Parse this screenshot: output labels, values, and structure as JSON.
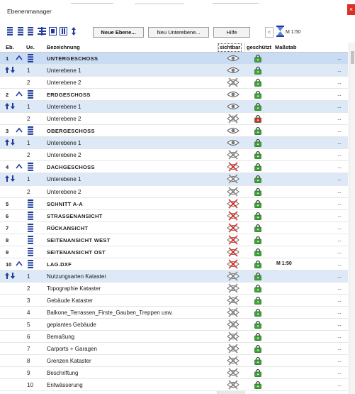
{
  "window": {
    "title": "Ebenenmanager",
    "close_glyph": "×"
  },
  "toolbar": {
    "icons": [
      "list-collapse-icon",
      "list-expand-icon",
      "list-icon",
      "sort-icon",
      "show-layer-icon",
      "hide-layer-icon",
      "sort-updown-icon"
    ],
    "new_layer_label": "Neue Ebene...",
    "new_sublayer_label": "Neu Unterebene...",
    "help_label": "Hilfe",
    "prev_glyph": "<",
    "scale_label": "M 1:50"
  },
  "columns": {
    "eb": "Eb.",
    "ue": "Ue.",
    "name": "Bezeichnung",
    "visible": "sichtbar",
    "protected": "geschützt",
    "scale": "Maßstab"
  },
  "colors": {
    "highlight_row": "#dde9f7",
    "selected_row": "#c9dcf3",
    "visible_col_bg": "#e9e9e9",
    "lock_green": "#3aa635",
    "lock_red": "#d9302a",
    "eye_hidden_red": "#e0312a"
  },
  "rows": [
    {
      "kind": "main",
      "eb": "1",
      "ue": "",
      "name": "UNTERGESCHOSS",
      "vis": "eye",
      "lock": "green",
      "scale": "",
      "more": "...",
      "arrow": true,
      "stack": true,
      "bg": "sel"
    },
    {
      "kind": "sub",
      "eb": "",
      "ue": "1",
      "name": "Unterebene 1",
      "vis": "eye",
      "lock": "green",
      "scale": "",
      "more": "...",
      "move": true,
      "bg": "hl"
    },
    {
      "kind": "sub",
      "eb": "",
      "ue": "2",
      "name": "Unterebene 2",
      "vis": "x-gray",
      "lock": "green",
      "scale": "",
      "more": "...",
      "bg": "none"
    },
    {
      "kind": "main",
      "eb": "2",
      "ue": "",
      "name": "ERDGESCHOSS",
      "vis": "eye",
      "lock": "green",
      "scale": "",
      "more": "...",
      "arrow": true,
      "stack": true,
      "bg": "none"
    },
    {
      "kind": "sub",
      "eb": "",
      "ue": "1",
      "name": "Unterebene 1",
      "vis": "eye",
      "lock": "green",
      "scale": "",
      "more": "...",
      "move": true,
      "bg": "hl"
    },
    {
      "kind": "sub",
      "eb": "",
      "ue": "2",
      "name": "Unterebene 2",
      "vis": "x-gray",
      "lock": "red",
      "scale": "",
      "more": "...",
      "bg": "none"
    },
    {
      "kind": "main",
      "eb": "3",
      "ue": "",
      "name": "OBERGESCHOSS",
      "vis": "eye",
      "lock": "green",
      "scale": "",
      "more": "...",
      "arrow": true,
      "stack": true,
      "bg": "none"
    },
    {
      "kind": "sub",
      "eb": "",
      "ue": "1",
      "name": "Unterebene 1",
      "vis": "eye",
      "lock": "green",
      "scale": "",
      "more": "...",
      "move": true,
      "bg": "hl"
    },
    {
      "kind": "sub",
      "eb": "",
      "ue": "2",
      "name": "Unterebene 2",
      "vis": "x-gray",
      "lock": "green",
      "scale": "",
      "more": "...",
      "bg": "none"
    },
    {
      "kind": "main",
      "eb": "4",
      "ue": "",
      "name": "DACHGESCHOSS",
      "vis": "x-red",
      "lock": "green",
      "scale": "",
      "more": "...",
      "arrow": true,
      "stack": true,
      "bg": "none"
    },
    {
      "kind": "sub",
      "eb": "",
      "ue": "1",
      "name": "Unterebene 1",
      "vis": "x-gray",
      "lock": "green",
      "scale": "",
      "more": "...",
      "move": true,
      "bg": "hl"
    },
    {
      "kind": "sub",
      "eb": "",
      "ue": "2",
      "name": "Unterebene 2",
      "vis": "x-gray",
      "lock": "green",
      "scale": "",
      "more": "...",
      "bg": "none"
    },
    {
      "kind": "main",
      "eb": "5",
      "ue": "",
      "name": "SCHNITT A-A",
      "vis": "x-red",
      "lock": "green",
      "scale": "",
      "more": "...",
      "stack": true,
      "bg": "none"
    },
    {
      "kind": "main",
      "eb": "6",
      "ue": "",
      "name": "STRASSENANSICHT",
      "vis": "x-red",
      "lock": "green",
      "scale": "",
      "more": "...",
      "stack": true,
      "bg": "none"
    },
    {
      "kind": "main",
      "eb": "7",
      "ue": "",
      "name": "RÜCKANSICHT",
      "vis": "x-red",
      "lock": "green",
      "scale": "",
      "more": "...",
      "stack": true,
      "bg": "none"
    },
    {
      "kind": "main",
      "eb": "8",
      "ue": "",
      "name": "SEITENANSICHT WEST",
      "vis": "x-red",
      "lock": "green",
      "scale": "",
      "more": "...",
      "stack": true,
      "bg": "none"
    },
    {
      "kind": "main",
      "eb": "9",
      "ue": "",
      "name": "SEITENANSICHT OST",
      "vis": "x-red",
      "lock": "green",
      "scale": "",
      "more": "...",
      "stack": true,
      "bg": "none"
    },
    {
      "kind": "main",
      "eb": "10",
      "ue": "",
      "name": "LAG.DXF",
      "vis": "x-red",
      "lock": "green",
      "scale": "M 1:50",
      "more": "...",
      "arrow": true,
      "stack": true,
      "bg": "none"
    },
    {
      "kind": "sub",
      "eb": "",
      "ue": "1",
      "name": "Nutzungsarten Kataster",
      "vis": "x-gray",
      "lock": "green",
      "scale": "",
      "more": "...",
      "move": true,
      "bg": "hl"
    },
    {
      "kind": "sub",
      "eb": "",
      "ue": "2",
      "name": "Topographie Kataster",
      "vis": "x-gray",
      "lock": "green",
      "scale": "",
      "more": "...",
      "bg": "none"
    },
    {
      "kind": "sub",
      "eb": "",
      "ue": "3",
      "name": "Gebäude Kataster",
      "vis": "x-gray",
      "lock": "green",
      "scale": "",
      "more": "...",
      "bg": "none"
    },
    {
      "kind": "sub",
      "eb": "",
      "ue": "4",
      "name": "Balkone_Terrassen_Firste_Gauben_Treppen usw.",
      "vis": "x-gray",
      "lock": "green",
      "scale": "",
      "more": "...",
      "bg": "none"
    },
    {
      "kind": "sub",
      "eb": "",
      "ue": "5",
      "name": "geplantes Gebäude",
      "vis": "x-gray",
      "lock": "green",
      "scale": "",
      "more": "...",
      "bg": "none"
    },
    {
      "kind": "sub",
      "eb": "",
      "ue": "6",
      "name": "Bemaßung",
      "vis": "x-gray",
      "lock": "green",
      "scale": "",
      "more": "...",
      "bg": "none"
    },
    {
      "kind": "sub",
      "eb": "",
      "ue": "7",
      "name": "Carports + Garagen",
      "vis": "x-gray",
      "lock": "green",
      "scale": "",
      "more": "...",
      "bg": "none"
    },
    {
      "kind": "sub",
      "eb": "",
      "ue": "8",
      "name": "Grenzen Kataster",
      "vis": "x-gray",
      "lock": "green",
      "scale": "",
      "more": "...",
      "bg": "none"
    },
    {
      "kind": "sub",
      "eb": "",
      "ue": "9",
      "name": "Beschriftung",
      "vis": "x-gray",
      "lock": "green",
      "scale": "",
      "more": "...",
      "bg": "none"
    },
    {
      "kind": "sub",
      "eb": "",
      "ue": "10",
      "name": "Entwässerung",
      "vis": "x-gray",
      "lock": "green",
      "scale": "",
      "more": "...",
      "bg": "none"
    }
  ]
}
